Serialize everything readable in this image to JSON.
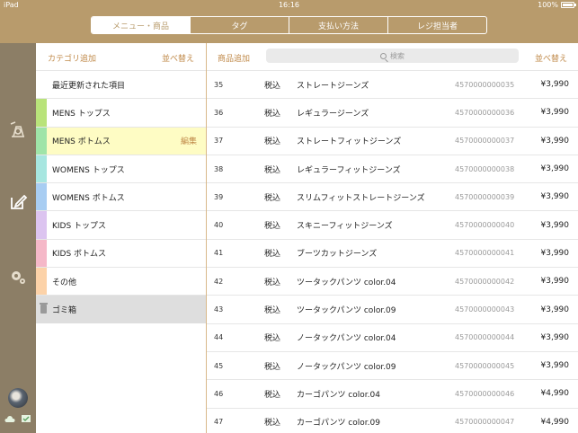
{
  "status": {
    "device": "iPad",
    "time": "16:16",
    "battery": "100%"
  },
  "tabs": [
    {
      "label": "メニュー・商品",
      "active": true
    },
    {
      "label": "タグ",
      "active": false
    },
    {
      "label": "支払い方法",
      "active": false
    },
    {
      "label": "レジ担当者",
      "active": false
    }
  ],
  "rail": {
    "icons": [
      "scale-icon",
      "edit-icon",
      "settings-icon"
    ]
  },
  "categories": {
    "add_label": "カテゴリ追加",
    "sort_label": "並べ替え",
    "edit_label": "編集",
    "items": [
      {
        "label": "最近更新された項目",
        "color": ""
      },
      {
        "label": "MENS トップス",
        "color": "#b9e37a"
      },
      {
        "label": "MENS ボトムス",
        "color": "#9fe4a8"
      },
      {
        "label": "WOMENS トップス",
        "color": "#a7e6e0"
      },
      {
        "label": "WOMENS ボトムス",
        "color": "#a8cdf2"
      },
      {
        "label": "KIDS トップス",
        "color": "#dcc4f0"
      },
      {
        "label": "KIDS ボトムス",
        "color": "#f5b8c8"
      },
      {
        "label": "その他",
        "color": "#fcd2a8"
      },
      {
        "label": "ゴミ箱",
        "color": ""
      }
    ]
  },
  "products": {
    "add_label": "商品追加",
    "sort_label": "並べ替え",
    "search_placeholder": "検索",
    "rows": [
      {
        "no": "35",
        "tax": "税込",
        "name": "ストレートジーンズ",
        "code": "4570000000035",
        "price": "¥3,990"
      },
      {
        "no": "36",
        "tax": "税込",
        "name": "レギュラージーンズ",
        "code": "4570000000036",
        "price": "¥3,990"
      },
      {
        "no": "37",
        "tax": "税込",
        "name": "ストレートフィットジーンズ",
        "code": "4570000000037",
        "price": "¥3,990"
      },
      {
        "no": "38",
        "tax": "税込",
        "name": "レギュラーフィットジーンズ",
        "code": "4570000000038",
        "price": "¥3,990"
      },
      {
        "no": "39",
        "tax": "税込",
        "name": "スリムフィットストレートジーンズ",
        "code": "4570000000039",
        "price": "¥3,990"
      },
      {
        "no": "40",
        "tax": "税込",
        "name": "スキニーフィットジーンズ",
        "code": "4570000000040",
        "price": "¥3,990"
      },
      {
        "no": "41",
        "tax": "税込",
        "name": "ブーツカットジーンズ",
        "code": "4570000000041",
        "price": "¥3,990"
      },
      {
        "no": "42",
        "tax": "税込",
        "name": "ツータックパンツ color.04",
        "code": "4570000000042",
        "price": "¥3,990"
      },
      {
        "no": "43",
        "tax": "税込",
        "name": "ツータックパンツ color.09",
        "code": "4570000000043",
        "price": "¥3,990"
      },
      {
        "no": "44",
        "tax": "税込",
        "name": "ノータックパンツ color.04",
        "code": "4570000000044",
        "price": "¥3,990"
      },
      {
        "no": "45",
        "tax": "税込",
        "name": "ノータックパンツ color.09",
        "code": "4570000000045",
        "price": "¥3,990"
      },
      {
        "no": "46",
        "tax": "税込",
        "name": "カーゴパンツ color.04",
        "code": "4570000000046",
        "price": "¥4,990"
      },
      {
        "no": "47",
        "tax": "税込",
        "name": "カーゴパンツ color.09",
        "code": "4570000000047",
        "price": "¥4,990"
      }
    ]
  },
  "colors": {
    "header": "#b89b6c",
    "rail": "#8c7e66",
    "accent": "#c08a4a",
    "selected_row": "#fefcc4"
  }
}
